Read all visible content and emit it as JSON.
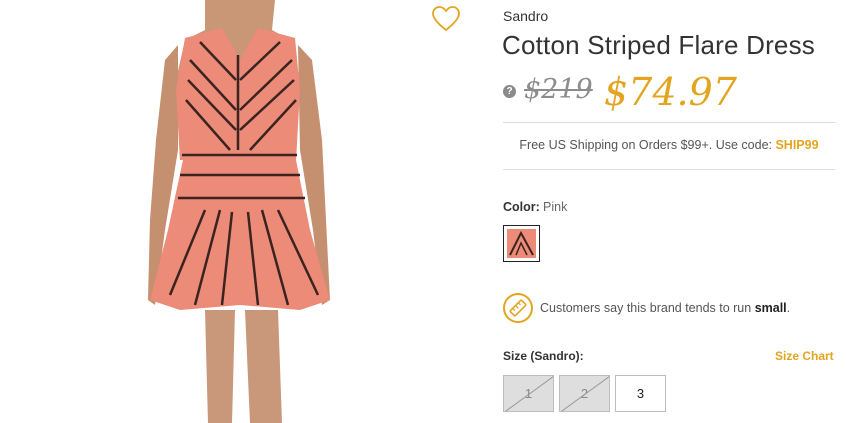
{
  "product": {
    "brand": "Sandro",
    "title": "Cotton Striped Flare Dress",
    "original_price": "$219",
    "sale_price": "$74.97"
  },
  "help_icon_glyph": "?",
  "shipping": {
    "text": "Free US Shipping on Orders $99+. Use code: ",
    "code": "SHIP99"
  },
  "color": {
    "label": "Color:",
    "value": "Pink",
    "swatch_color": "#ec8b78"
  },
  "fit_note": {
    "prefix": "Customers say this brand tends to run ",
    "emphasis": "small",
    "suffix": "."
  },
  "size": {
    "label": "Size (Sandro):",
    "chart_link": "Size Chart",
    "options": [
      {
        "label": "1",
        "available": false
      },
      {
        "label": "2",
        "available": false
      },
      {
        "label": "3",
        "available": true
      }
    ]
  },
  "icons": {
    "favorite": "heart-outline-icon",
    "fit": "ruler-icon",
    "help": "question-circle-icon"
  },
  "colors": {
    "accent": "#e3a51f",
    "text": "#333333",
    "dress": "#ec8b78"
  }
}
